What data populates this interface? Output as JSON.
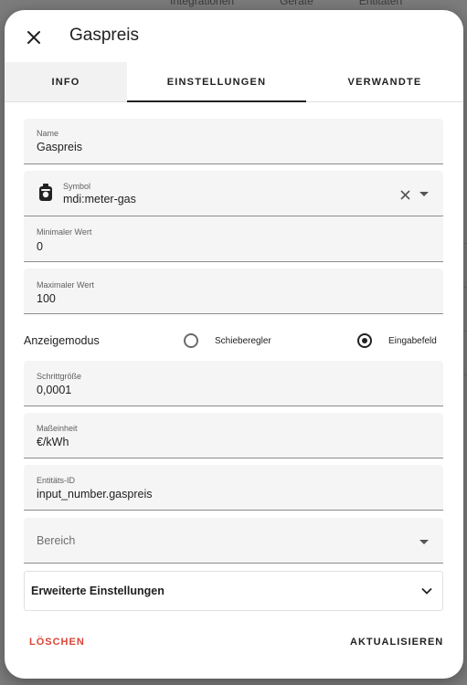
{
  "background": {
    "tabs": [
      "Integrationen",
      "Geräte",
      "Entitäten"
    ]
  },
  "dialog": {
    "title": "Gaspreis",
    "close_icon": "close-icon"
  },
  "tabs": [
    {
      "label": "INFO",
      "active": false
    },
    {
      "label": "EINSTELLUNGEN",
      "active": true
    },
    {
      "label": "VERWANDTE",
      "active": false
    }
  ],
  "fields": {
    "name": {
      "label": "Name",
      "value": "Gaspreis"
    },
    "symbol": {
      "label": "Symbol",
      "value": "mdi:meter-gas",
      "icon": "meter-gas-icon"
    },
    "min": {
      "label": "Minimaler Wert",
      "value": "0"
    },
    "max": {
      "label": "Maximaler Wert",
      "value": "100"
    },
    "step": {
      "label": "Schrittgröße",
      "value": "0,0001"
    },
    "unit": {
      "label": "Maßeinheit",
      "value": "€/kWh"
    },
    "entity_id": {
      "label": "Entitäts-ID",
      "value": "input_number.gaspreis"
    },
    "area": {
      "placeholder": "Bereich"
    }
  },
  "display_mode": {
    "label": "Anzeigemodus",
    "options": [
      {
        "label": "Schieberegler",
        "checked": false
      },
      {
        "label": "Eingabefeld",
        "checked": true
      }
    ]
  },
  "advanced": {
    "label": "Erweiterte Einstellungen"
  },
  "actions": {
    "delete_label": "LÖSCHEN",
    "update_label": "AKTUALISIEREN"
  },
  "colors": {
    "danger": "#db4437",
    "field_bg": "#f5f5f5",
    "text": "#212121"
  }
}
